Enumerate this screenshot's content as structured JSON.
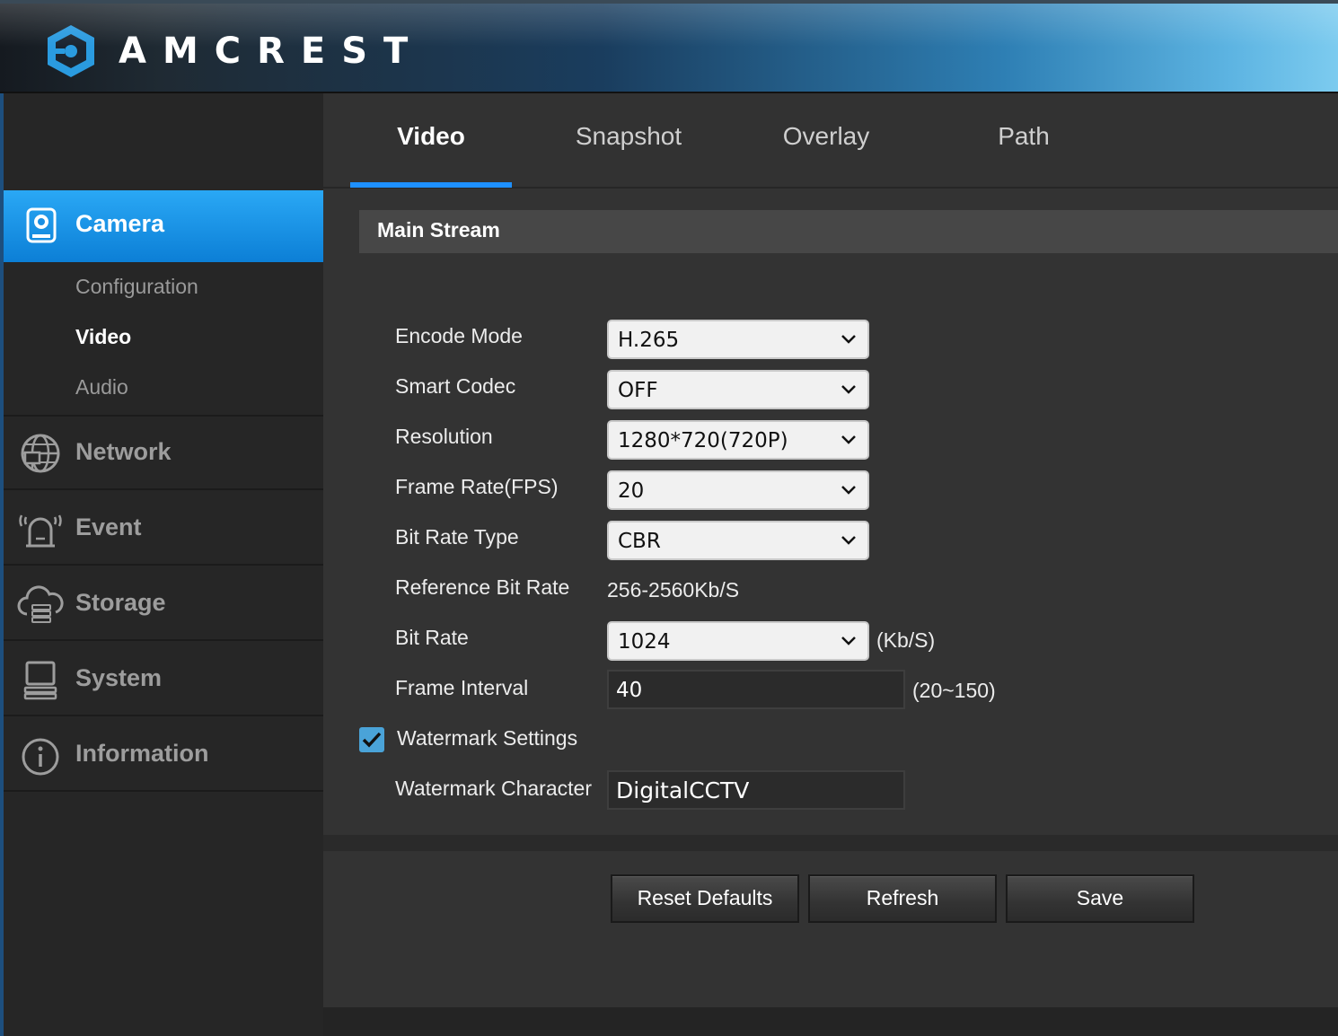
{
  "header": {
    "brand": "AMCREST"
  },
  "sidebar": {
    "camera_label": "Camera",
    "sub_items": [
      {
        "label": "Configuration",
        "active": false
      },
      {
        "label": "Video",
        "active": true
      },
      {
        "label": "Audio",
        "active": false
      }
    ],
    "items": [
      {
        "label": "Network",
        "icon": "network-globe-icon"
      },
      {
        "label": "Event",
        "icon": "alarm-icon"
      },
      {
        "label": "Storage",
        "icon": "cloud-storage-icon"
      },
      {
        "label": "System",
        "icon": "computer-icon"
      },
      {
        "label": "Information",
        "icon": "info-icon"
      }
    ]
  },
  "tabs": [
    {
      "label": "Video",
      "active": true
    },
    {
      "label": "Snapshot",
      "active": false
    },
    {
      "label": "Overlay",
      "active": false
    },
    {
      "label": "Path",
      "active": false
    }
  ],
  "section_title": "Main Stream",
  "form": {
    "encode_mode": {
      "label": "Encode Mode",
      "value": "H.265"
    },
    "smart_codec": {
      "label": "Smart Codec",
      "value": "OFF"
    },
    "resolution": {
      "label": "Resolution",
      "value": "1280*720(720P)"
    },
    "frame_rate": {
      "label": "Frame Rate(FPS)",
      "value": "20"
    },
    "bit_rate_type": {
      "label": "Bit Rate Type",
      "value": "CBR"
    },
    "reference_bit_rate": {
      "label": "Reference Bit Rate",
      "value": "256-2560Kb/S"
    },
    "bit_rate": {
      "label": "Bit Rate",
      "value": "1024",
      "unit": "(Kb/S)"
    },
    "frame_interval": {
      "label": "Frame Interval",
      "value": "40",
      "range": "(20~150)"
    },
    "watermark_settings": {
      "label": "Watermark Settings",
      "checked": true
    },
    "watermark_character": {
      "label": "Watermark Character",
      "value": "DigitalCCTV"
    }
  },
  "buttons": {
    "reset": "Reset Defaults",
    "refresh": "Refresh",
    "save": "Save"
  },
  "colors": {
    "accent": "#1e90ff",
    "checkbox": "#4aa3d8"
  }
}
